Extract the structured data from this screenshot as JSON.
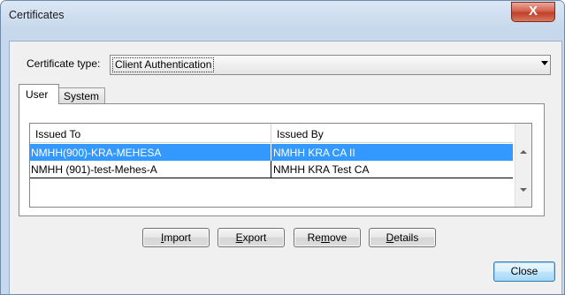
{
  "window": {
    "title": "Certificates",
    "close_glyph": "X"
  },
  "certificate_type": {
    "label": "Certificate type:",
    "value": "Client Authentication"
  },
  "tabs": [
    {
      "label": "User",
      "selected": true
    },
    {
      "label": "System",
      "selected": false
    }
  ],
  "table": {
    "columns": [
      "Issued To",
      "Issued By"
    ],
    "rows": [
      {
        "issued_to": "NMHH(900)-KRA-MEHESA",
        "issued_by": "NMHH KRA CA II",
        "selected": true
      },
      {
        "issued_to": "NMHH (901)-test-Mehes-A",
        "issued_by": "NMHH KRA Test CA",
        "selected": false
      }
    ]
  },
  "buttons": {
    "import": {
      "access": "I",
      "rest": "mport"
    },
    "export": {
      "access": "E",
      "rest": "xport"
    },
    "remove": {
      "pre": "Re",
      "access": "m",
      "rest": "ove"
    },
    "details": {
      "access": "D",
      "rest": "etails"
    },
    "close": "Close"
  },
  "colors": {
    "selection": "#3399ff",
    "titlebar": "#c7d8ec",
    "close_button": "#c0402a"
  }
}
